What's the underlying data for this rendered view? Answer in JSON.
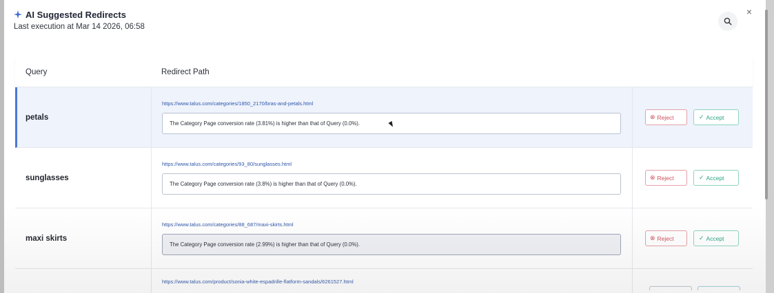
{
  "modal": {
    "title": "AI Suggested Redirects",
    "subtitle": "Last execution at Mar 14 2026, 06:58",
    "icons": {
      "title": "sparkle-icon",
      "search": "search-icon",
      "close": "close-icon"
    },
    "close_glyph": "×"
  },
  "table": {
    "columns": [
      "Query",
      "Redirect Path"
    ],
    "rows": [
      {
        "query": "petals",
        "path": "https://www.talus.com/categories/1850_2170/bras-and-petals.html",
        "reason": "The Category Page conversion rate (3.81%) is higher than that of Query (0.0%).",
        "reject": "Reject",
        "accept": "Accept"
      },
      {
        "query": "sunglasses",
        "path": "https://www.talus.com/categories/93_80/sunglasses.html",
        "reason": "The Category Page conversion rate (3.8%) is higher than that of Query (0.0%).",
        "reject": "Reject",
        "accept": "Accept"
      },
      {
        "query": "maxi skirts",
        "path": "https://www.talus.com/categories/88_687/maxi-skirts.html",
        "reason": "The Category Page conversion rate (2.99%) is higher than that of Query (0.0%).",
        "reject": "Reject",
        "accept": "Accept"
      },
      {
        "query": "",
        "path": "https://www.talus.com/product/sonia-white-espadrille-flatform-sandals/6261527.html"
      }
    ]
  },
  "colors": {
    "accent": "#4a78d4",
    "reject": "#d0505c",
    "accept": "#2aa384",
    "link": "#2f55a8"
  }
}
